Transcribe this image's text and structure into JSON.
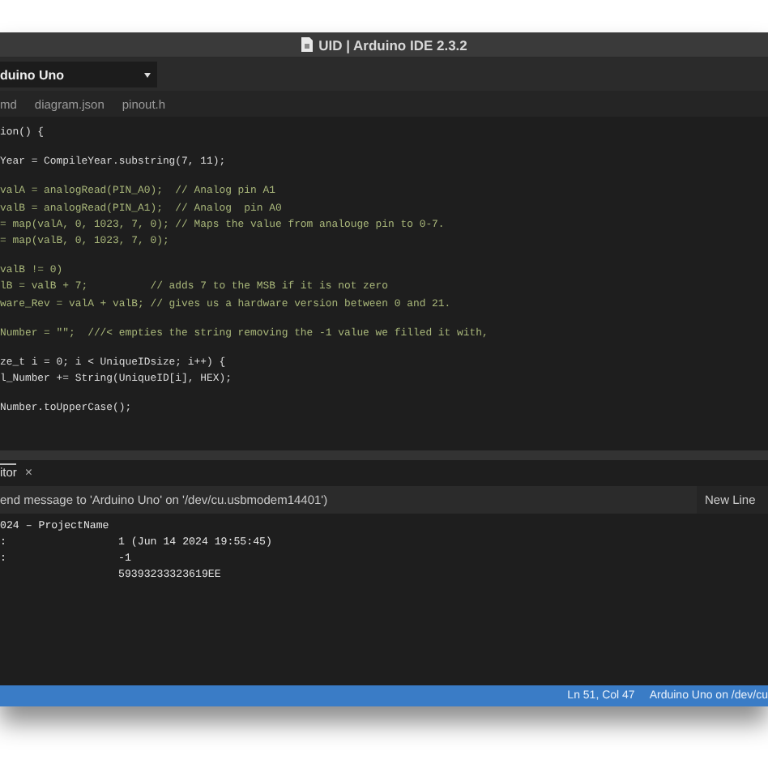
{
  "window": {
    "title": "UID | Arduino IDE 2.3.2"
  },
  "toolbar": {
    "board": "duino Uno"
  },
  "tabs": [
    {
      "label": "md"
    },
    {
      "label": "diagram.json"
    },
    {
      "label": "pinout.h"
    }
  ],
  "editor": {
    "lines": [
      {
        "kind": "code",
        "text": "ion() {"
      },
      {
        "kind": "blank"
      },
      {
        "kind": "code",
        "text": "Year = CompileYear.substring(7, 11);"
      },
      {
        "kind": "blank"
      },
      {
        "kind": "comment",
        "text": "valA = analogRead(PIN_A0);  // Analog pin A1"
      },
      {
        "kind": "comment",
        "text": "valB = analogRead(PIN_A1);  // Analog  pin A0"
      },
      {
        "kind": "comment",
        "text": "= map(valA, 0, 1023, 7, 0); // Maps the value from analouge pin to 0-7."
      },
      {
        "kind": "comment",
        "text": "= map(valB, 0, 1023, 7, 0);"
      },
      {
        "kind": "blank"
      },
      {
        "kind": "comment",
        "text": "valB != 0)"
      },
      {
        "kind": "comment",
        "text": "lB = valB + 7;          // adds 7 to the MSB if it is not zero"
      },
      {
        "kind": "comment",
        "text": "ware_Rev = valA + valB; // gives us a hardware version between 0 and 21."
      },
      {
        "kind": "blank"
      },
      {
        "kind": "comment",
        "text": "Number = \"\";  ///< empties the string removing the -1 value we filled it with,"
      },
      {
        "kind": "blank"
      },
      {
        "kind": "code",
        "text": "ze_t i = 0; i < UniqueIDsize; i++) {"
      },
      {
        "kind": "code",
        "text": "l_Number += String(UniqueID[i], HEX);"
      },
      {
        "kind": "blank"
      },
      {
        "kind": "code",
        "text": "Number.toUpperCase();"
      }
    ]
  },
  "serial_monitor": {
    "tab": "itor",
    "close": "×",
    "input": {
      "placeholder": "end message to 'Arduino Uno' on '/dev/cu.usbmodem14401')"
    },
    "line_ending": "New Line",
    "output": [
      {
        "label": "024 – ProjectName"
      },
      {
        "label": ":",
        "value": "1 (Jun 14 2024 19:55:45)"
      },
      {
        "label": ":",
        "value": "-1"
      },
      {
        "value": "59393233323619EE"
      }
    ]
  },
  "status_bar": {
    "position": "Ln 51, Col 47",
    "board": "Arduino Uno on /dev/cu"
  }
}
